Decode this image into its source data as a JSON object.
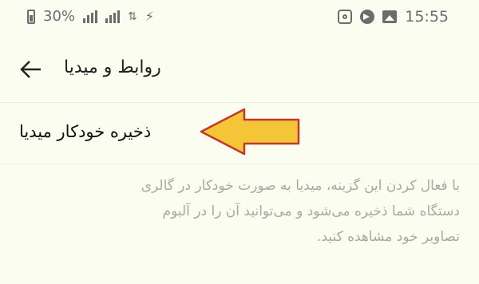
{
  "status_bar": {
    "battery_text": "30%",
    "time": "15:55",
    "icons": [
      "battery-icon",
      "signal-icon",
      "signal-icon",
      "data-icon",
      "no-wifi-icon",
      "instagram-icon",
      "telegram-icon",
      "gallery-icon"
    ]
  },
  "header": {
    "title": "ﺭﻭﺍﺑﻂ ﻭ ﻣﯿﺪﯾﺎ",
    "back_icon": "arrow-left-icon"
  },
  "setting": {
    "label": "ﺫﺧﯿﺮﻩ ﺧﻮﺩﮐﺎﺭ ﻣﯿﺪﯾﺎ"
  },
  "description": {
    "line1": "ﺑﺎ ﻓﻌﺎﻝ ﮐﺮﺩﻥ ﺍﯾﻦ ﮔﺰﯾﻨﻪ، ﻣﯿﺪﯾﺎ ﺑﻪ ﺻﻮﺭﺕ ﺧﻮﺩﮐﺎﺭ ﺩﺭ ﮔﺎﻟﺮﯼ",
    "line2": "ﺩﺳﺘﮕﺎﻩ ﺷﻤﺎ ﺫﺧﯿﺮﻩ ﻣﯽ‌ﺷﻮﺩ ﻭ ﻣﯽ‌ﺗﻮﺍﻧﯿﺪ ﺁﻥ ﺭﺍ ﺩﺭ ﺁﻟﺒﻮﻡ",
    "line3": "ﺗﺼﺎﻭﯾﺮ ﺧﻮﺩ ﻣﺸﺎﻫﺪﻩ ﮐﻨﯿﺪ."
  },
  "annotation": {
    "arrow_fill": "#f4c536",
    "arrow_stroke": "#c0392b"
  }
}
